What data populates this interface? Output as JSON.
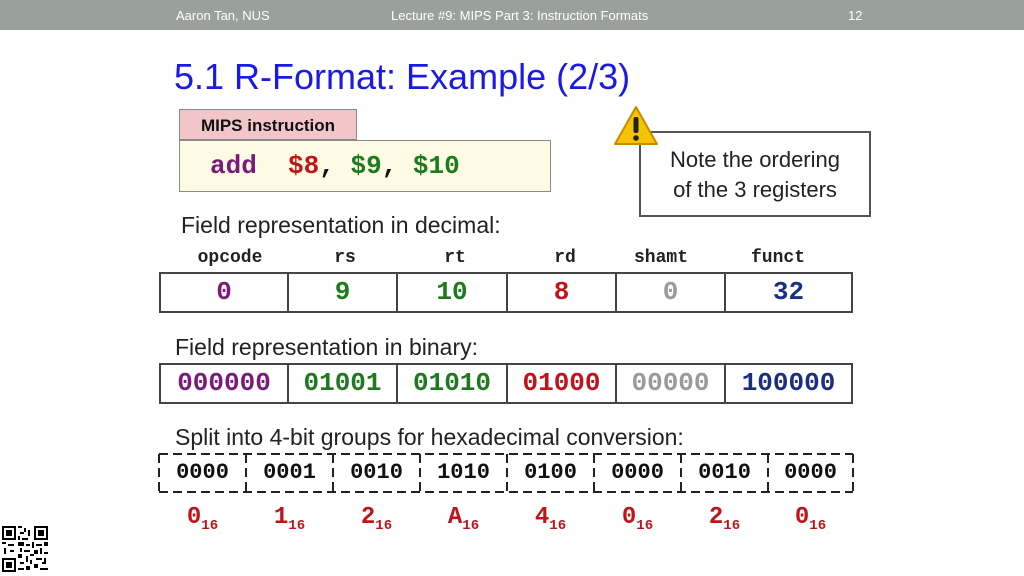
{
  "header": {
    "author": "Aaron Tan, NUS",
    "lecture": "Lecture #9: MIPS Part 3: Instruction Formats",
    "page": "12"
  },
  "title": "5.1 R-Format: Example (2/3)",
  "mips_label": "MIPS instruction",
  "instruction": {
    "op": "add",
    "rd": "$8",
    "sep1": ", ",
    "rs": "$9",
    "sep2": ", ",
    "rt": "$10"
  },
  "note": {
    "line1": "Note the ordering",
    "line2": "of the 3 registers"
  },
  "decimal_label": "Field representation in decimal:",
  "binary_label": "Field representation in binary:",
  "hex_label": "Split into 4-bit groups for hexadecimal conversion:",
  "fields": [
    "opcode",
    "rs",
    "rt",
    "rd",
    "shamt",
    "funct"
  ],
  "decimal_values": [
    "0",
    "9",
    "10",
    "8",
    "0",
    "32"
  ],
  "binary_values": [
    "000000",
    "01001",
    "01010",
    "01000",
    "00000",
    "100000"
  ],
  "nibbles": [
    "0000",
    "0001",
    "0010",
    "1010",
    "0100",
    "0000",
    "0010",
    "0000"
  ],
  "hex_digits": [
    "0",
    "1",
    "2",
    "A",
    "4",
    "0",
    "2",
    "0"
  ],
  "hex_subscript": "16",
  "colors": {
    "title": "#1a1ae6",
    "purple": "#7a1a7a",
    "red": "#c0141a",
    "green": "#1e7a1e",
    "gray": "#9a9a9a",
    "navy": "#1a2f80",
    "header_bar": "#9aa19a"
  },
  "icons": [
    "warning-icon",
    "qr-code-icon"
  ]
}
